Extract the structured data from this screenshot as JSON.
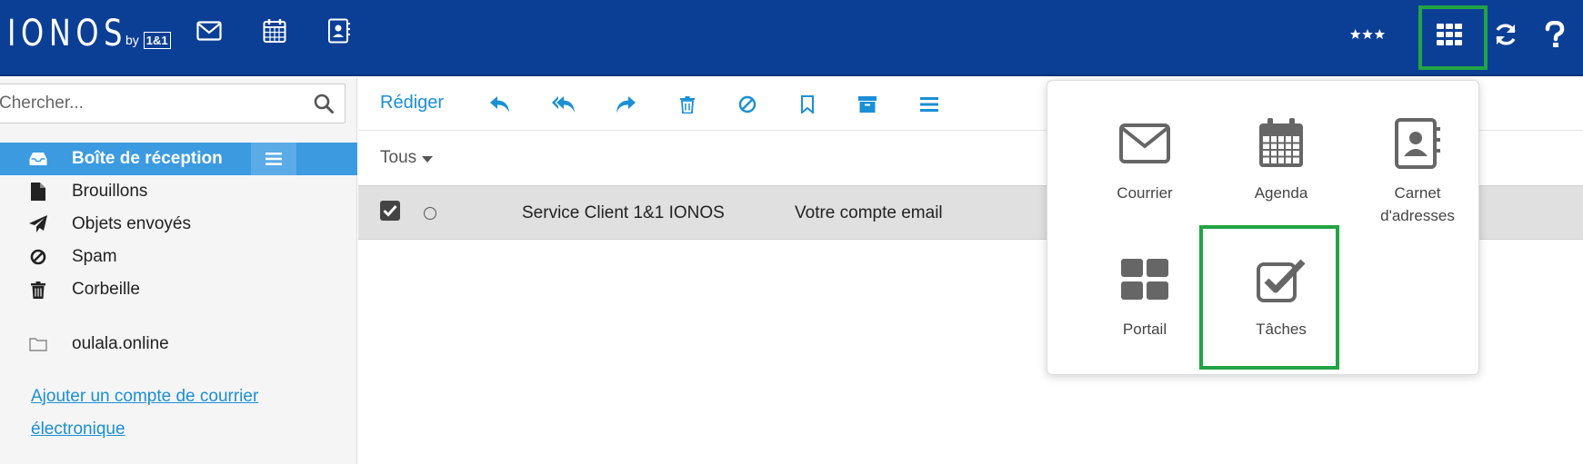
{
  "header": {
    "logo_word": "IONOS",
    "logo_by": "by",
    "logo_box": "1&1"
  },
  "search": {
    "placeholder": "Chercher..."
  },
  "sidebar": {
    "folders": [
      {
        "label": "Boîte de réception"
      },
      {
        "label": "Brouillons"
      },
      {
        "label": "Objets envoyés"
      },
      {
        "label": "Spam"
      },
      {
        "label": "Corbeille"
      }
    ],
    "account": "oulala.online",
    "add_account_line1": "Ajouter un compte de courrier",
    "add_account_line2": "électronique"
  },
  "toolbar": {
    "compose_label": "Rédiger"
  },
  "list": {
    "filter_label": "Tous",
    "rows": [
      {
        "sender": "Service Client 1&1 IONOS",
        "subject": "Votre compte email"
      }
    ]
  },
  "apps_menu": {
    "items": [
      {
        "label": "Courrier"
      },
      {
        "label": "Agenda"
      },
      {
        "label": "Carnet",
        "label2": "d'adresses"
      },
      {
        "label": "Portail"
      },
      {
        "label": "Tâches"
      }
    ]
  },
  "colors": {
    "header": "#0b3f96",
    "active_folder": "#3c9be0",
    "link": "#1a8fd5",
    "highlight": "#22a444"
  }
}
